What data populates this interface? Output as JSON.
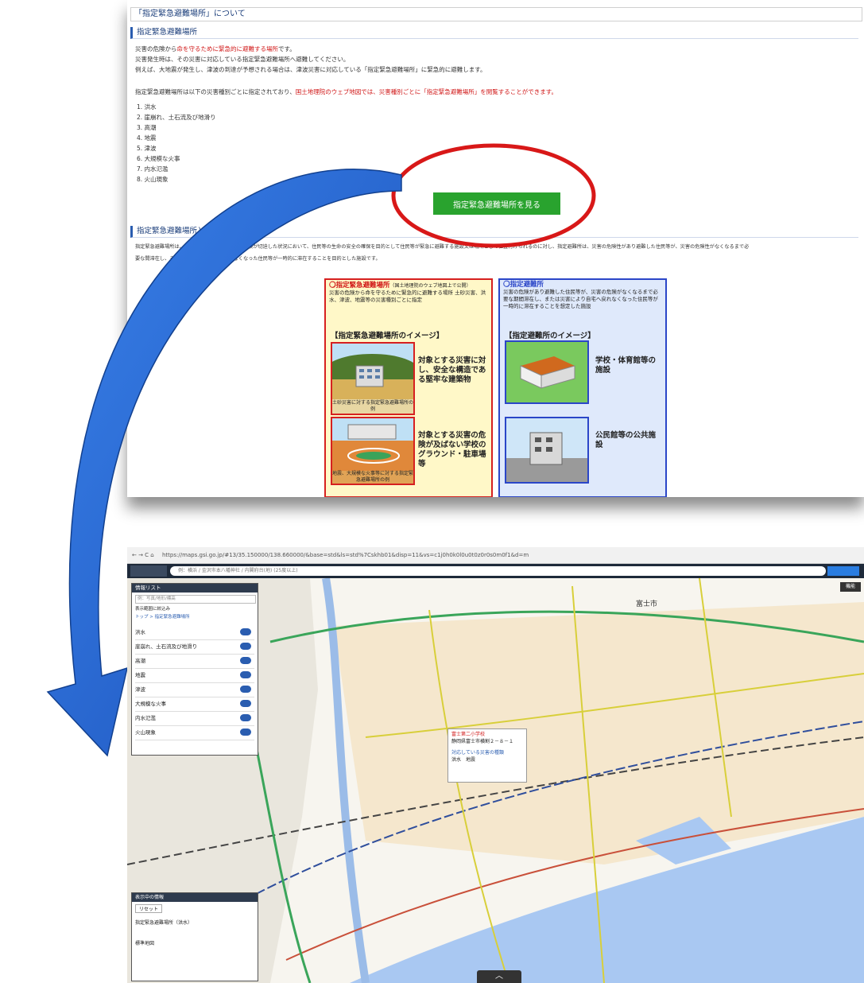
{
  "top": {
    "title": "「指定緊急避難場所」について",
    "section1": "指定緊急避難場所",
    "intro": [
      {
        "pre": "災害の危険から",
        "red": "命を守るために緊急的に避難する場所",
        "post": "です。"
      },
      {
        "pre": "災害発生時は、その災害に対応している指定緊急避難場所へ避難してください。",
        "red": "",
        "post": ""
      },
      {
        "pre": "例えば、大地震が発生し、津波の到達が予想される場合は、津波災害に対応している「指定緊急避難場所」に緊急的に避難します。",
        "red": "",
        "post": ""
      }
    ],
    "hazard_note_pre": "指定緊急避難場所は以下の災害種別ごとに指定されており、",
    "hazard_note_red": "国土地理院のウェブ地図では、災害種別ごとに「指定緊急避難場所」を閲覧することができます。",
    "hazards": [
      "1. 洪水",
      "2. 崖崩れ、土石流及び地滑り",
      "3. 高潮",
      "4. 地震",
      "5. 津波",
      "6. 大規模な火事",
      "7. 内水氾濫",
      "8. 火山現象"
    ],
    "view_button": "指定緊急避難場所を見る",
    "section2": "指定緊急避難場所と指定避難所の違い",
    "diff_text_1": "指定緊急避難場所は、津波、洪水等、災害による危険が切迫した状況において、住民等の生命の安全の確保を目的として住民等が緊急に避難する施設又は場所として位置付けられるのに対し、指定避難所は、災害の危険性があり避難した住民等が、災害の危険性がなくなるまで必",
    "diff_text_2": "要な間滞在し、または災害により自宅へ戻れなくなった住民等が一時的に滞在することを目的とした施設です。",
    "left_box": {
      "heading_red": "〇指定緊急避難場所",
      "heading_note": "（国土地理院のウェブ地図上で公開）",
      "desc": "災害の危険から命を守るために緊急的に避難する場所 土砂災害、洪水、津波、地震等の災害種別ごとに指定",
      "image_title": "【指定緊急避難場所のイメージ】",
      "cap1": "対象とする災害に対し、安全な構造である堅牢な建築物",
      "small1": "土砂災害に対する指定緊急避難場所の例",
      "cap2": "対象とする災害の危険が及ばない学校のグラウンド・駐車場等",
      "small2": "地震、大規模な火事等に対する指定緊急避難場所の例"
    },
    "right_box": {
      "heading_blue": "〇指定避難所",
      "desc": "災害の危険があり避難した住民等が、災害の危険がなくなるまで必要な期間滞在し、または災害により自宅へ戻れなくなった住民等が一時的に滞在することを想定した施設",
      "image_title": "【指定避難所のイメージ】",
      "cap1": "学校・体育館等の施設",
      "cap2": "公民館等の公共施設"
    }
  },
  "map": {
    "url": "https://maps.gsi.go.jp/#13/35.150000/138.660000/&base=std&ls=std%7Cskhb01&disp=11&vs=c1j0h0k0l0u0t0z0r0s0m0f1&d=m",
    "search_placeholder": "例：横浜 / 金沢市本八幡神社 / 内閣府台(地) (25度以上)",
    "layer_panel_title": "情報リスト",
    "layer_panel_search": "例：写真/地形/標高",
    "layer_panel_toggle": "表示範囲に絞込み",
    "layer_panel_breadcrumb": "トップ > 指定緊急避難場所",
    "layers": [
      "洪水",
      "崖崩れ、土石流及び地滑り",
      "高潮",
      "地震",
      "津波",
      "大規模な火事",
      "内水氾濫",
      "火山現象"
    ],
    "layer_tag": "解説",
    "popup_title": "富士第二小学校",
    "popup_address": "静岡県富士市横割２－８－１",
    "popup_heading": "対応している災害の種類",
    "popup_types": "洪水　地震",
    "city_label": "富士市",
    "bottom_panel_title": "表示中の情報",
    "bottom_panel_reset": "リセット",
    "bottom_item1": "指定緊急避難場所（洪水）",
    "bottom_item2": "標準地図",
    "right_tool": "機能",
    "scroll_up": "︿"
  },
  "colors": {
    "accent_red": "#d01515",
    "button_green": "#29a32e",
    "arrow_blue": "#1e5fd0",
    "circle_red": "#d81818"
  }
}
